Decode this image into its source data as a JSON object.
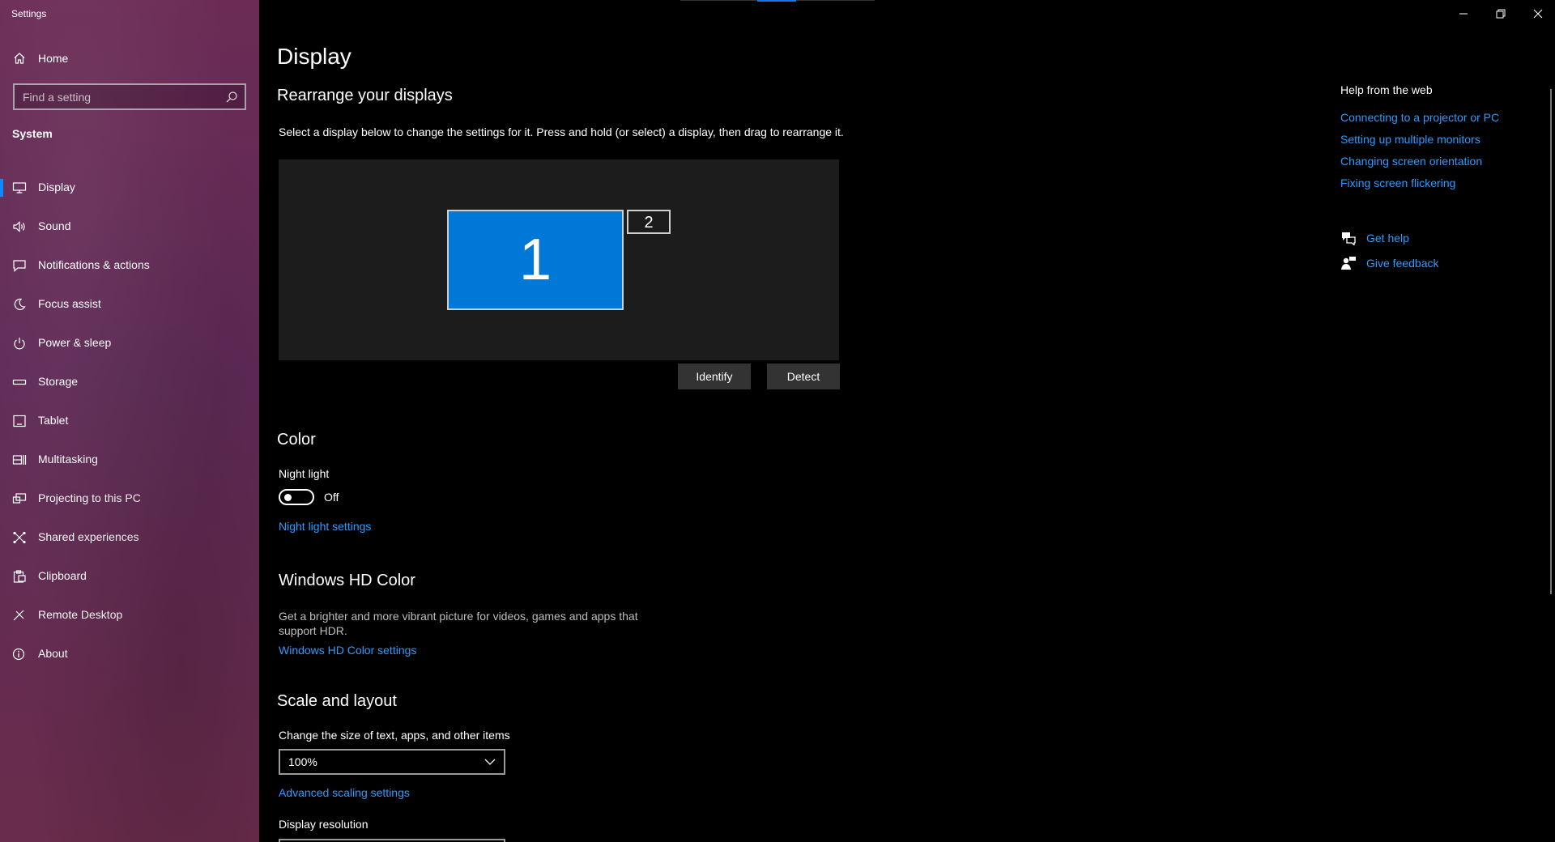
{
  "app": {
    "title": "Settings"
  },
  "window_controls": {
    "minimize_icon": "minimize-icon",
    "restore_icon": "restore-icon",
    "close_icon": "close-icon"
  },
  "sidebar": {
    "home_label": "Home",
    "search_placeholder": "Find a setting",
    "section_label": "System",
    "items": [
      {
        "label": "Display",
        "icon": "monitor-icon",
        "active": true
      },
      {
        "label": "Sound",
        "icon": "speaker-icon"
      },
      {
        "label": "Notifications & actions",
        "icon": "notification-icon"
      },
      {
        "label": "Focus assist",
        "icon": "moon-icon"
      },
      {
        "label": "Power & sleep",
        "icon": "power-icon"
      },
      {
        "label": "Storage",
        "icon": "storage-icon"
      },
      {
        "label": "Tablet",
        "icon": "tablet-icon"
      },
      {
        "label": "Multitasking",
        "icon": "multitasking-icon"
      },
      {
        "label": "Projecting to this PC",
        "icon": "projecting-icon"
      },
      {
        "label": "Shared experiences",
        "icon": "shared-experiences-icon"
      },
      {
        "label": "Clipboard",
        "icon": "clipboard-icon"
      },
      {
        "label": "Remote Desktop",
        "icon": "remote-desktop-icon"
      },
      {
        "label": "About",
        "icon": "info-icon"
      }
    ]
  },
  "main": {
    "page_title": "Display",
    "rearrange": {
      "heading": "Rearrange your displays",
      "description": "Select a display below to change the settings for it. Press and hold (or select) a display, then drag to rearrange it.",
      "monitor1": "1",
      "monitor2": "2",
      "identify_label": "Identify",
      "detect_label": "Detect"
    },
    "color": {
      "heading": "Color",
      "night_light_label": "Night light",
      "night_light_state": "Off",
      "night_light_settings_link": "Night light settings"
    },
    "hdr": {
      "heading": "Windows HD Color",
      "description": "Get a brighter and more vibrant picture for videos, games and apps that support HDR.",
      "settings_link": "Windows HD Color settings"
    },
    "scale": {
      "heading": "Scale and layout",
      "size_label": "Change the size of text, apps, and other items",
      "size_value": "100%",
      "advanced_link": "Advanced scaling settings",
      "resolution_label": "Display resolution"
    }
  },
  "help": {
    "title": "Help from the web",
    "links": [
      "Connecting to a projector or PC",
      "Setting up multiple monitors",
      "Changing screen orientation",
      "Fixing screen flickering"
    ],
    "get_help": "Get help",
    "give_feedback": "Give feedback"
  },
  "colors": {
    "accent": "#0078d7",
    "link": "#2b9cff",
    "sidebar": "#5e2a56"
  }
}
